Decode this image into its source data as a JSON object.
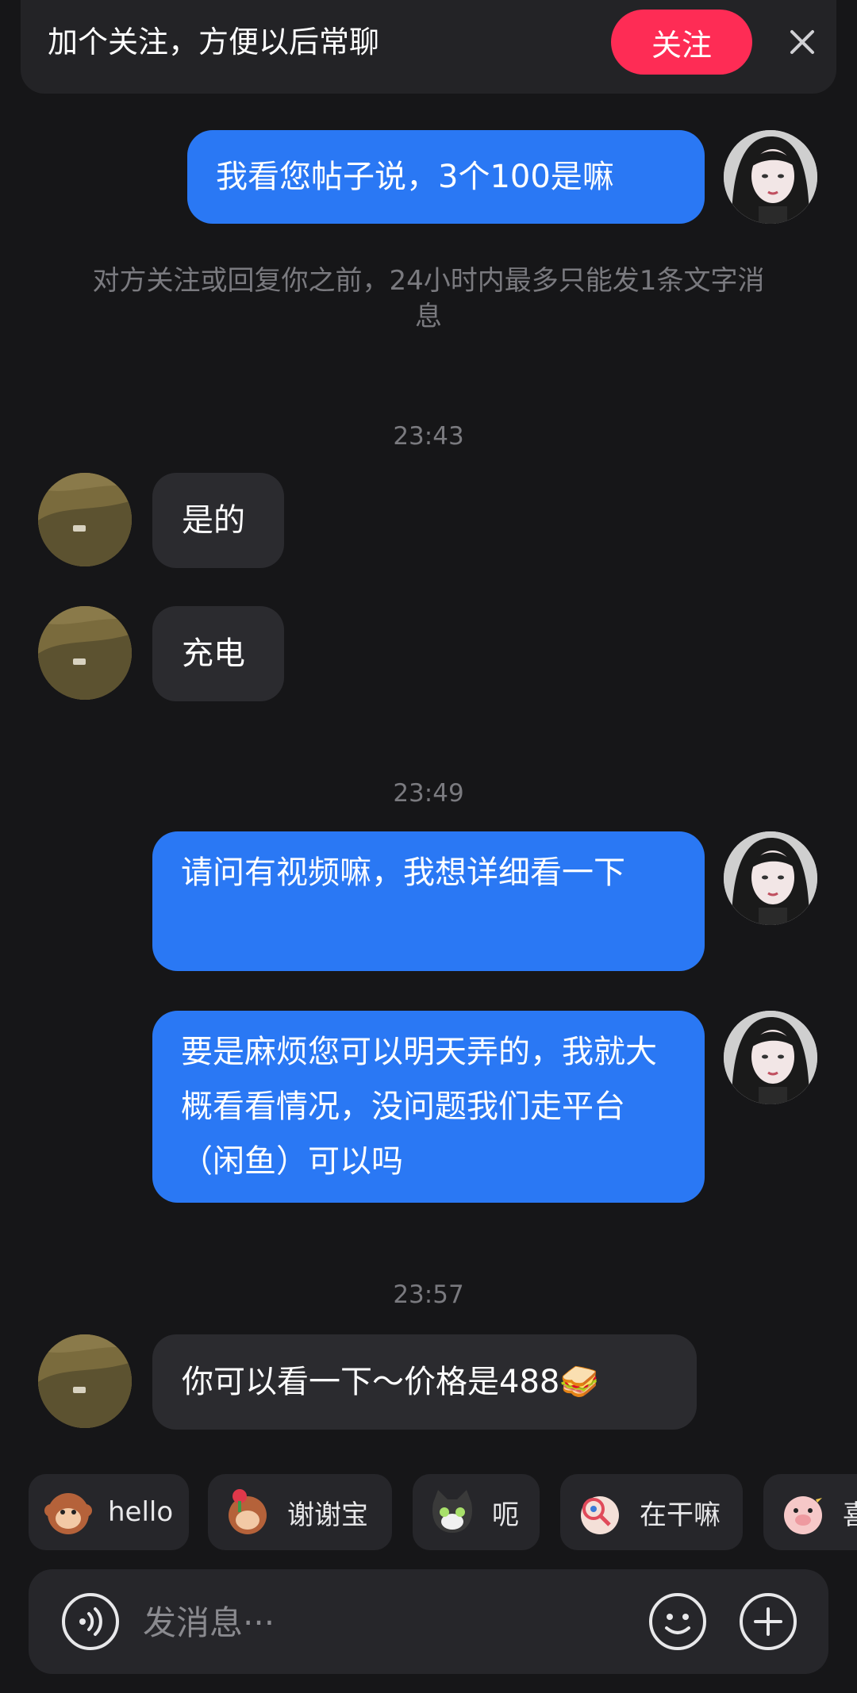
{
  "follow_banner": {
    "text": "加个关注，方便以后常聊",
    "button_label": "关注",
    "close_icon": "close-icon"
  },
  "messages": {
    "m1": "我看您帖子说，3个100是嘛",
    "system_note": "对方关注或回复你之前，24小时内最多只能发1条文字消息",
    "time1": "23:43",
    "m2": "是的",
    "m3": "充电",
    "time2": "23:49",
    "m4": "请问有视频嘛，我想详细看一下",
    "m5": "要是麻烦您可以明天弄的，我就大概看看情况，没问题我们走平台（闲鱼）可以吗",
    "time3": "23:57",
    "m6": "你可以看一下～价格是488🥪"
  },
  "quick_replies": [
    {
      "label": "hello",
      "icon": "monkey-emoji-icon"
    },
    {
      "label": "谢谢宝",
      "icon": "monkey-flower-emoji-icon"
    },
    {
      "label": "呃",
      "icon": "cat-emoji-icon"
    },
    {
      "label": "在干嘛",
      "icon": "magnifier-emoji-icon"
    },
    {
      "label": "喜",
      "icon": "pig-emoji-icon"
    }
  ],
  "input": {
    "placeholder": "发消息···",
    "voice_icon": "voice-icon",
    "emoji_icon": "smiley-icon",
    "plus_icon": "plus-icon"
  },
  "colors": {
    "background": "#161618",
    "outgoing_bubble": "#2a78f4",
    "incoming_bubble": "#2b2b2f",
    "follow_button": "#fe2c55"
  }
}
